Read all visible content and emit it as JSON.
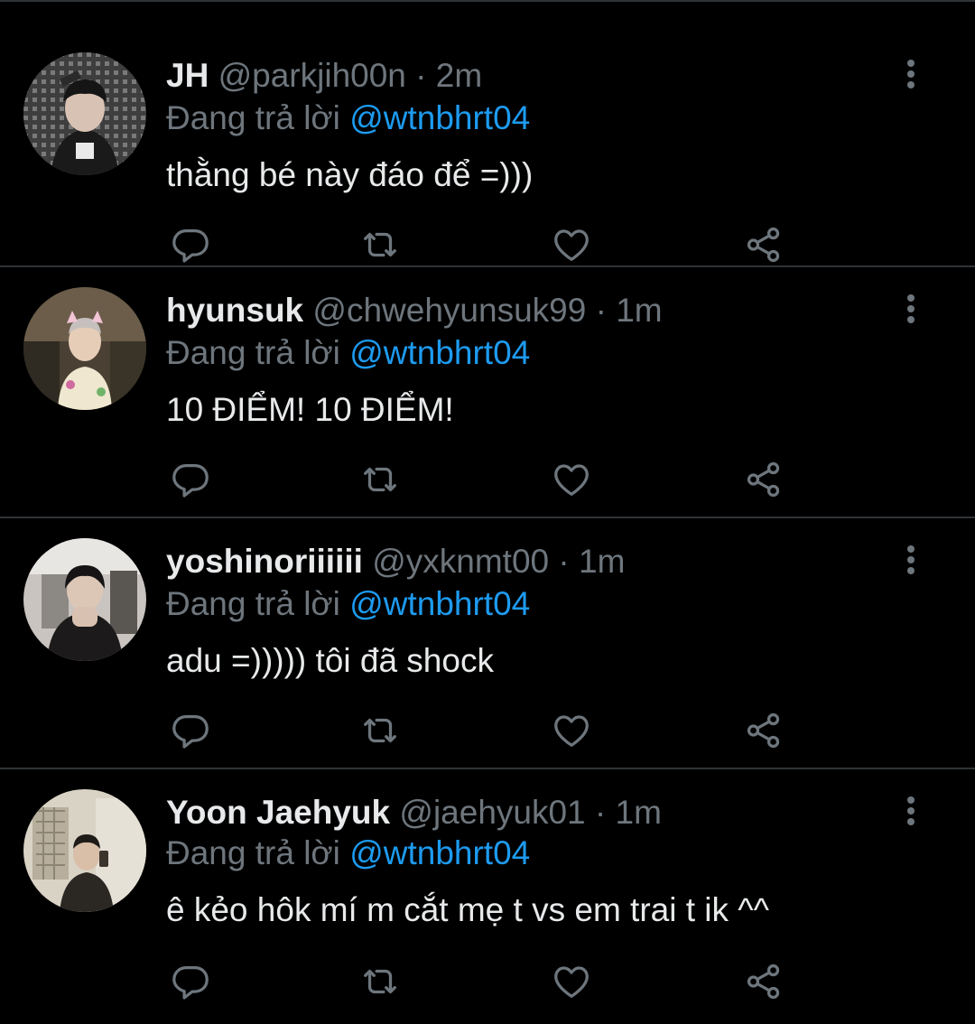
{
  "colors": {
    "background": "#000000",
    "divider": "#2f3336",
    "primary_text": "#e7e9ea",
    "secondary_text": "#6e767d",
    "accent": "#1d9bf0"
  },
  "tweets": [
    {
      "name": "JH",
      "handle": "@parkjih00n",
      "separator": "·",
      "time": "2m",
      "reply_prefix": "Đang trả lời",
      "reply_to": "@wtnbhrt04",
      "text": "thằng bé này đáo để =)))",
      "avatar_icon": "avatar-photo"
    },
    {
      "name": "hyunsuk",
      "handle": "@chwehyunsuk99",
      "separator": "·",
      "time": "1m",
      "reply_prefix": "Đang trả lời",
      "reply_to": "@wtnbhrt04",
      "text": "10 ĐIỂM! 10 ĐIỂM!",
      "avatar_icon": "avatar-photo"
    },
    {
      "name": "yoshinoriiiiii",
      "handle": "@yxknmt00",
      "separator": "·",
      "time": "1m",
      "reply_prefix": "Đang trả lời",
      "reply_to": "@wtnbhrt04",
      "text": "adu =))))) tôi đã shock",
      "avatar_icon": "avatar-photo"
    },
    {
      "name": "Yoon Jaehyuk",
      "handle": "@jaehyuk01",
      "separator": "·",
      "time": "1m",
      "reply_prefix": "Đang trả lời",
      "reply_to": "@wtnbhrt04",
      "text": "ê kẻo hôk mí m cắt mẹ t vs em trai t ik ^^",
      "avatar_icon": "avatar-photo"
    }
  ],
  "action_icons": [
    "reply-icon",
    "retweet-icon",
    "like-icon",
    "share-icon"
  ],
  "more_icon": "more-vertical-icon"
}
